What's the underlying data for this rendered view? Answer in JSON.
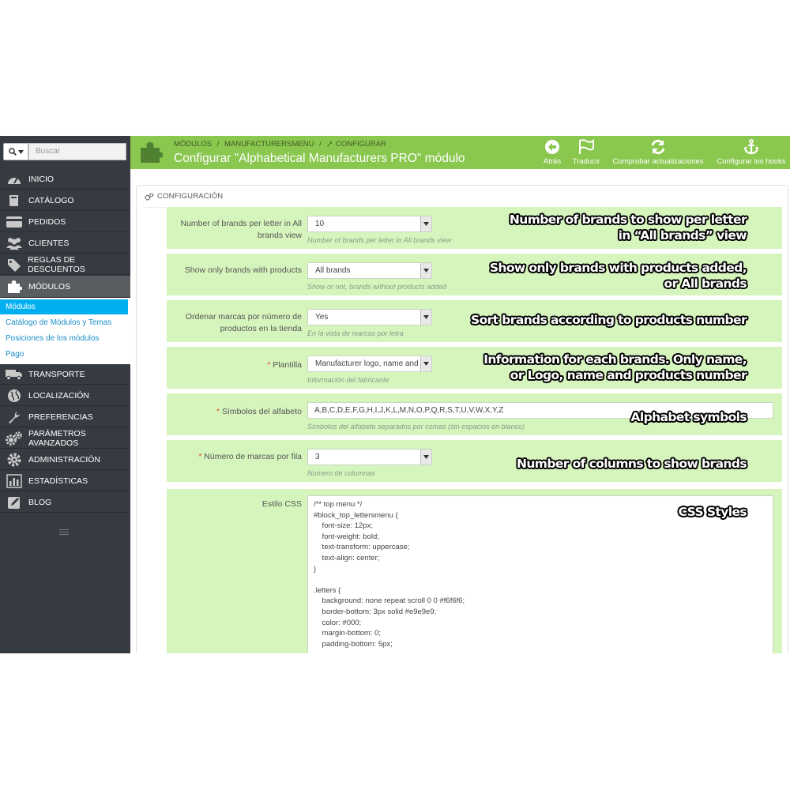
{
  "search": {
    "filter_icon": "search-icon",
    "placeholder": "Buscar"
  },
  "sidebar": {
    "items": [
      {
        "label": "INICIO",
        "icon": "dashboard-icon"
      },
      {
        "label": "CATÁLOGO",
        "icon": "book-icon"
      },
      {
        "label": "PEDIDOS",
        "icon": "credit-card-icon"
      },
      {
        "label": "CLIENTES",
        "icon": "users-icon"
      },
      {
        "label": "REGLAS DE DESCUENTOS",
        "icon": "tags-icon"
      },
      {
        "label": "MÓDULOS",
        "icon": "puzzle-icon",
        "active": true
      },
      {
        "label": "TRANSPORTE",
        "icon": "truck-icon"
      },
      {
        "label": "LOCALIZACIÓN",
        "icon": "globe-icon"
      },
      {
        "label": "PREFERENCIAS",
        "icon": "wrench-icon"
      },
      {
        "label": "PARÁMETROS AVANZADOS",
        "icon": "cogs-icon"
      },
      {
        "label": "ADMINISTRACIÓN",
        "icon": "gear-icon"
      },
      {
        "label": "ESTADÍSTICAS",
        "icon": "bar-chart-icon"
      },
      {
        "label": "BLOG",
        "icon": "edit-icon"
      }
    ],
    "subitems": [
      {
        "label": "Módulos",
        "active": true
      },
      {
        "label": "Catálogo de Módulos y Temas"
      },
      {
        "label": "Posiciones de los módulos"
      },
      {
        "label": "Pago"
      }
    ]
  },
  "header": {
    "breadcrumb": [
      "MÓDULOS",
      "/",
      "MANUFACTURERSMENU",
      "/",
      "CONFIGURAR"
    ],
    "title": "Configurar \"Alphabetical Manufacturers PRO\" módulo",
    "toolbar": [
      {
        "label": "Atrás",
        "icon": "back-arrow-icon"
      },
      {
        "label": "Traducir",
        "icon": "flag-icon"
      },
      {
        "label": "Comprobar actualizaciones",
        "icon": "refresh-icon"
      },
      {
        "label": "Configurar los hooks",
        "icon": "anchor-icon"
      }
    ]
  },
  "panel": {
    "title": "CONFIGURACIÓN",
    "fields": [
      {
        "label": "Number of brands per letter in All brands view",
        "value": "10",
        "help": "Number of brands per letter in All brands view",
        "required": false,
        "callout": [
          "Number of brands to show per letter",
          "in “All brands” view"
        ]
      },
      {
        "label": "Show only brands with products",
        "value": "All brands",
        "help": "Show or not, brands without products added",
        "required": false,
        "callout": [
          "Show only brands with products added,",
          "or All brands"
        ]
      },
      {
        "label": "Ordenar marcas por número de productos en la tienda",
        "value": "Yes",
        "help": "En la vista de marcas por letra",
        "required": false,
        "callout": [
          "Sort brands according to products number"
        ]
      },
      {
        "label": "Plantilla",
        "value": "Manufacturer logo, name and products number",
        "help": "Información del fabricante",
        "required": true,
        "callout": [
          "Information for each brands. Only name,",
          "or Logo, name and products number"
        ]
      },
      {
        "label": "Símbolos del alfabeto",
        "value": "A,B,C,D,E,F,G,H,I,J,K,L,M,N,O,P,Q,R,S,T,U,V,W,X,Y,Z",
        "help": "Símbolos del alfabeto separados por comas (sin espacios en blanco)",
        "required": true,
        "callout": [
          "Alphabet symbols"
        ]
      },
      {
        "label": "Número de marcas por fila",
        "value": "3",
        "help": "Numero de columnas",
        "required": true,
        "callout": [
          "Number of columns to show brands"
        ]
      },
      {
        "label": "Estilo CSS",
        "required": false,
        "value": "/** top menu */\n#block_top_lettersmenu {\n    font-size: 12px;\n    font-weight: bold;\n    text-transform: uppercase;\n    text-align: center;\n}\n\n.letters {\n    background: none repeat scroll 0 0 #f6f6f6;\n    border-bottom: 3px solid #e9e9e9;\n    color: #000;\n    margin-bottom: 0;\n    padding-bottom: 5px;",
        "callout": [
          "CSS Styles"
        ]
      }
    ]
  },
  "colors": {
    "header": "#8ac74f",
    "row": "#d6f5bd",
    "sidebar": "#363a41",
    "active_sub": "#00aff0"
  }
}
